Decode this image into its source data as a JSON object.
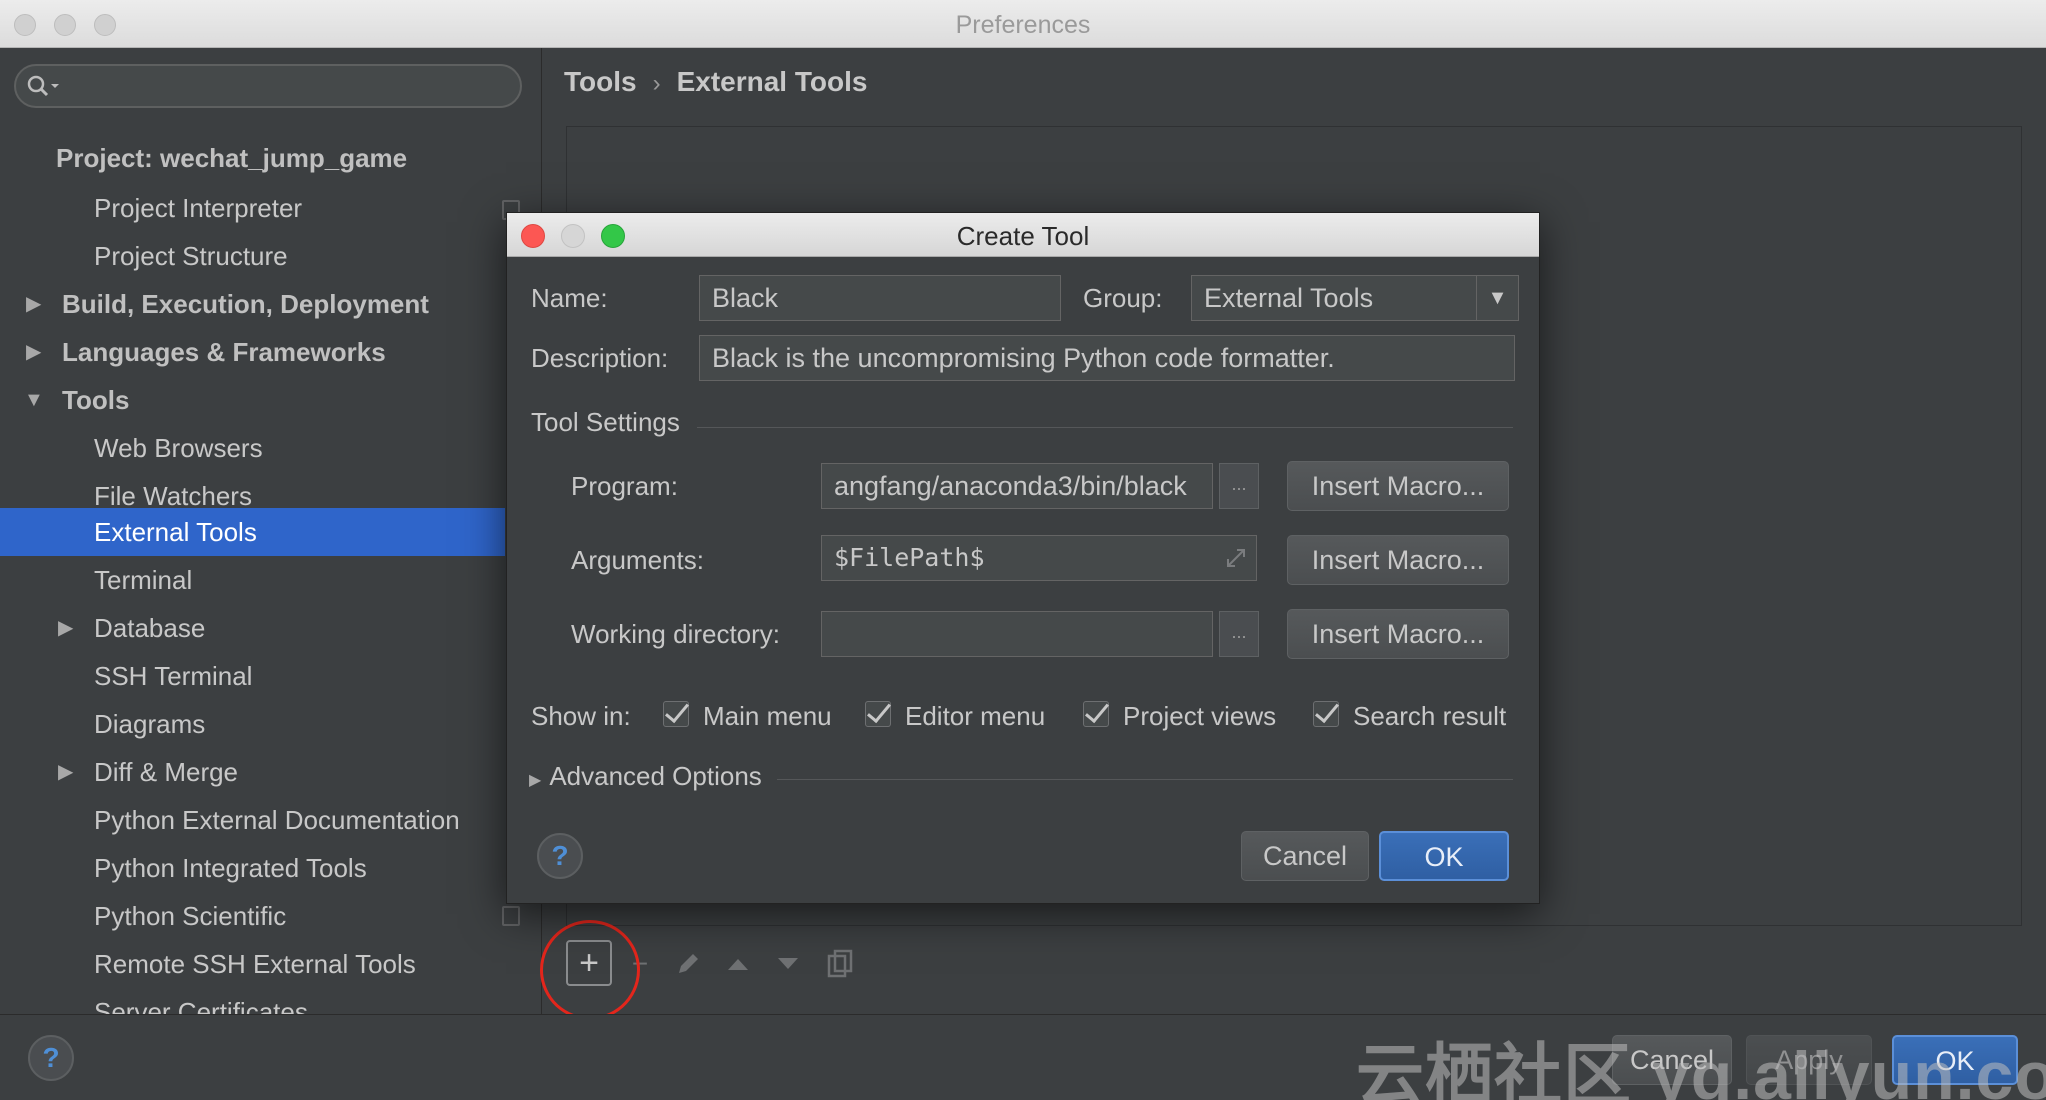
{
  "window": {
    "title": "Preferences"
  },
  "sidebar": {
    "search_placeholder": "",
    "project_header": "Project: wechat_jump_game",
    "items": [
      {
        "label": "Project Interpreter"
      },
      {
        "label": "Project Structure"
      },
      {
        "label": "Build, Execution, Deployment"
      },
      {
        "label": "Languages & Frameworks"
      },
      {
        "label": "Tools"
      },
      {
        "label": "Web Browsers"
      },
      {
        "label": "File Watchers"
      },
      {
        "label": "External Tools"
      },
      {
        "label": "Terminal"
      },
      {
        "label": "Database"
      },
      {
        "label": "SSH Terminal"
      },
      {
        "label": "Diagrams"
      },
      {
        "label": "Diff & Merge"
      },
      {
        "label": "Python External Documentation"
      },
      {
        "label": "Python Integrated Tools"
      },
      {
        "label": "Python Scientific"
      },
      {
        "label": "Remote SSH External Tools"
      },
      {
        "label": "Server Certificates"
      }
    ]
  },
  "breadcrumb": {
    "parent": "Tools",
    "separator": "›",
    "current": "External Tools"
  },
  "dialog": {
    "title": "Create Tool",
    "name_label": "Name:",
    "name_value": "Black",
    "group_label": "Group:",
    "group_value": "External Tools",
    "description_label": "Description:",
    "description_value": "Black is the uncompromising Python code formatter.",
    "tool_settings_label": "Tool Settings",
    "program_label": "Program:",
    "program_value": "angfang/anaconda3/bin/black",
    "arguments_label": "Arguments:",
    "arguments_value": "$FilePath$",
    "working_dir_label": "Working directory:",
    "working_dir_value": "",
    "insert_macro_label": "Insert Macro...",
    "browse_label": "...",
    "show_in_label": "Show in:",
    "show_in": [
      {
        "label": "Main menu",
        "checked": true
      },
      {
        "label": "Editor menu",
        "checked": true
      },
      {
        "label": "Project views",
        "checked": true
      },
      {
        "label": "Search result",
        "checked": true
      }
    ],
    "advanced_label": "Advanced Options",
    "help_label": "?",
    "cancel_label": "Cancel",
    "ok_label": "OK"
  },
  "footer": {
    "help_label": "?",
    "cancel_label": "Cancel",
    "apply_label": "Apply",
    "ok_label": "OK"
  },
  "watermark": "云栖社区 yq.aliyun.com",
  "colors": {
    "selection": "#2f65ca",
    "annotation_circle": "#e3261c",
    "close": "#fc5753",
    "zoom": "#33c748"
  }
}
